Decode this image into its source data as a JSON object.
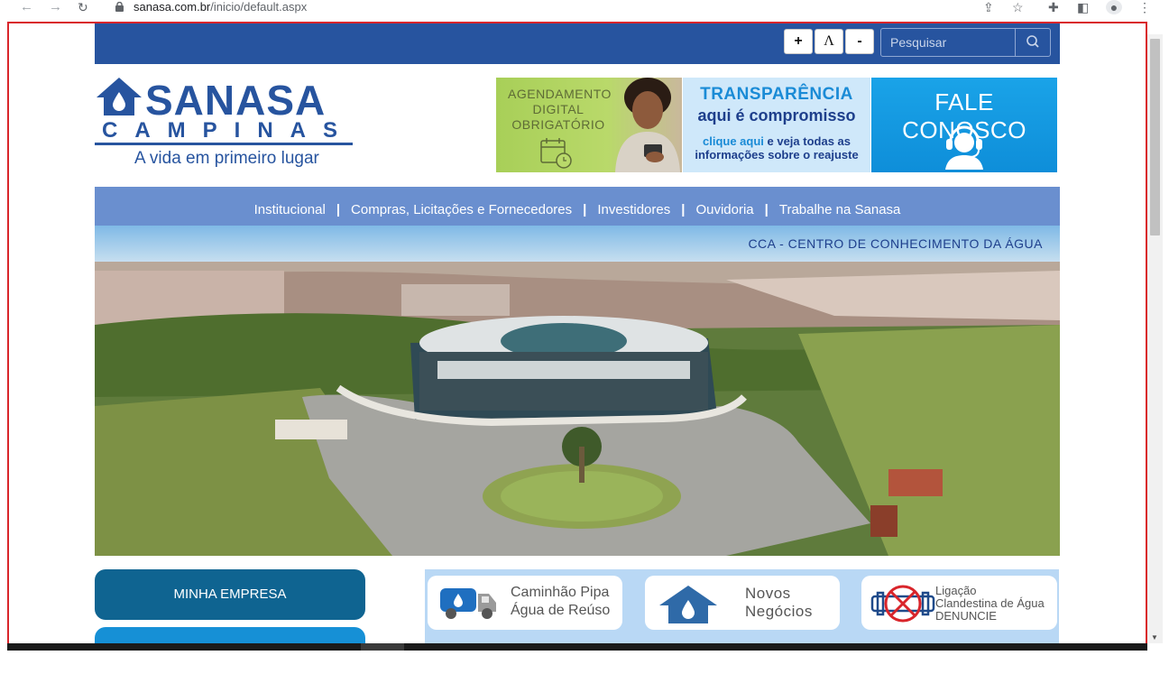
{
  "browser": {
    "url_domain": "sanasa.com.br",
    "url_path": "/inicio/default.aspx"
  },
  "topbar": {
    "font_increase": "+",
    "font_normal": "A",
    "font_decrease": "-",
    "search_placeholder": "Pesquisar"
  },
  "logo": {
    "name": "SANASA",
    "city": "CAMPINAS",
    "tagline": "A vida em primeiro lugar"
  },
  "banners": {
    "agendamento": [
      "AGENDAMENTO",
      "DIGITAL",
      "OBRIGATÓRIO"
    ],
    "transparencia_title": "TRANSPARÊNCIA",
    "transparencia_sub": "aqui é compromisso",
    "transparencia_link": "clique aqui",
    "transparencia_rest1": " e veja todas as",
    "transparencia_rest2": "informações sobre o reajuste",
    "fale_conosco": "FALE CONOSCO"
  },
  "menu": {
    "items": [
      "Institucional",
      "Compras, Licitações e Fornecedores",
      "Investidores",
      "Ouvidoria",
      "Trabalhe na Sanasa"
    ],
    "separator": "|"
  },
  "hero": {
    "caption": "CCA - CENTRO DE CONHECIMENTO DA ÁGUA"
  },
  "sidebar": {
    "minha_empresa": "MINHA EMPRESA"
  },
  "cards": {
    "caminhao": [
      "Caminhão Pipa",
      "Água de Reúso"
    ],
    "novos": [
      "Novos",
      "Negócios"
    ],
    "ligacao": [
      "Ligação",
      "Clandestina de Água",
      "DENUNCIE"
    ]
  },
  "colors": {
    "brand_blue": "#27549f",
    "menu_blue": "#6a8fcf",
    "accent_cyan": "#1aa3e8"
  }
}
